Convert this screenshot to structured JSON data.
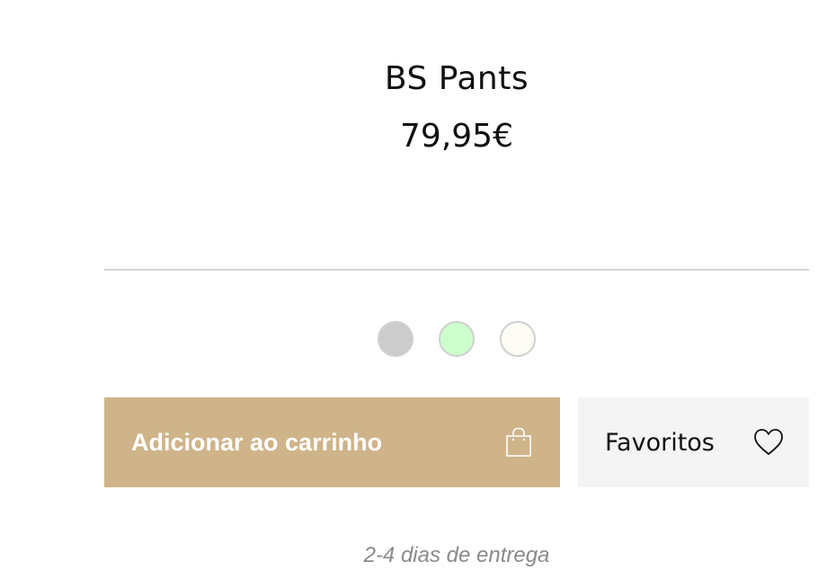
{
  "product": {
    "title": "BS Pants",
    "price": "79,95€"
  },
  "swatches": [
    {
      "name": "gray",
      "color": "#cccccc"
    },
    {
      "name": "light-green",
      "color": "#ccffcc"
    },
    {
      "name": "ivory",
      "color": "#fdfdf5"
    }
  ],
  "actions": {
    "add_to_cart_label": "Adicionar ao carrinho",
    "add_to_cart_icon": "shopping-bag-icon",
    "favorites_label": "Favoritos",
    "favorites_icon": "heart-icon"
  },
  "delivery": {
    "text": "2-4 dias de entrega"
  },
  "colors": {
    "accent": "#cfb48a",
    "favorites_bg": "#f4f4f4",
    "divider": "#d5d5d5",
    "muted_text": "#8a8a8a"
  }
}
